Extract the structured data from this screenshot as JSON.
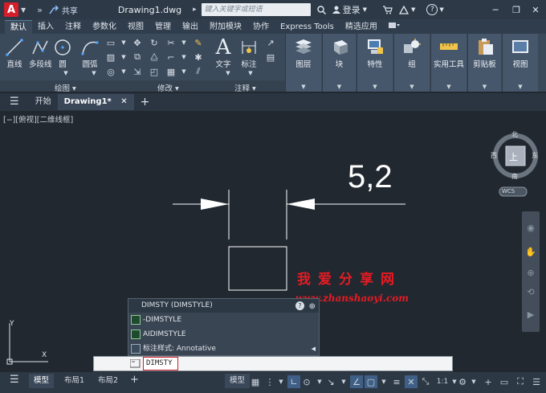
{
  "titlebar": {
    "logo": "A",
    "share": "共享",
    "doc_title": "Drawing1.dwg",
    "search_placeholder": "键入关键字或短语",
    "login": "登录",
    "help": "?"
  },
  "ribbon_tabs": [
    "默认",
    "插入",
    "注释",
    "参数化",
    "视图",
    "管理",
    "输出",
    "附加模块",
    "协作",
    "Express Tools",
    "精选应用"
  ],
  "ribbon": {
    "draw": {
      "label": "绘图",
      "buttons": [
        "直线",
        "多段线",
        "圆",
        "圆弧"
      ]
    },
    "modify": {
      "label": "修改"
    },
    "annotation": {
      "label": "注释",
      "buttons": [
        "文字",
        "标注"
      ]
    },
    "panels": [
      "图层",
      "块",
      "特性",
      "组",
      "实用工具",
      "剪贴板",
      "视图"
    ]
  },
  "file_tabs": {
    "start": "开始",
    "active": "Drawing1*"
  },
  "viewport": {
    "label": "[−][俯视][二维线框]",
    "dimension_text": "5,2",
    "viewcube": {
      "north": "北",
      "south": "南",
      "east": "东",
      "west": "西",
      "face": "上",
      "wcs": "WCS"
    },
    "ucs": {
      "x": "X",
      "y": "Y"
    }
  },
  "autocomplete": {
    "header": "DIMSTY (DIMSTYLE)",
    "items": [
      "-DIMSTYLE",
      "AIDIMSTYLE",
      "标注样式: Annotative"
    ]
  },
  "command_line": {
    "input": "DIMSTY"
  },
  "status": {
    "tabs": [
      "模型",
      "布局1",
      "布局2"
    ],
    "model": "模型",
    "scale": "1:1"
  },
  "watermark": {
    "line1": "我爱分享网",
    "line2": "www.zhanshaoyi.com"
  },
  "colors": {
    "accent": "#d51e2a",
    "ribbon": "#3b4a5b",
    "canvas": "#212830"
  }
}
